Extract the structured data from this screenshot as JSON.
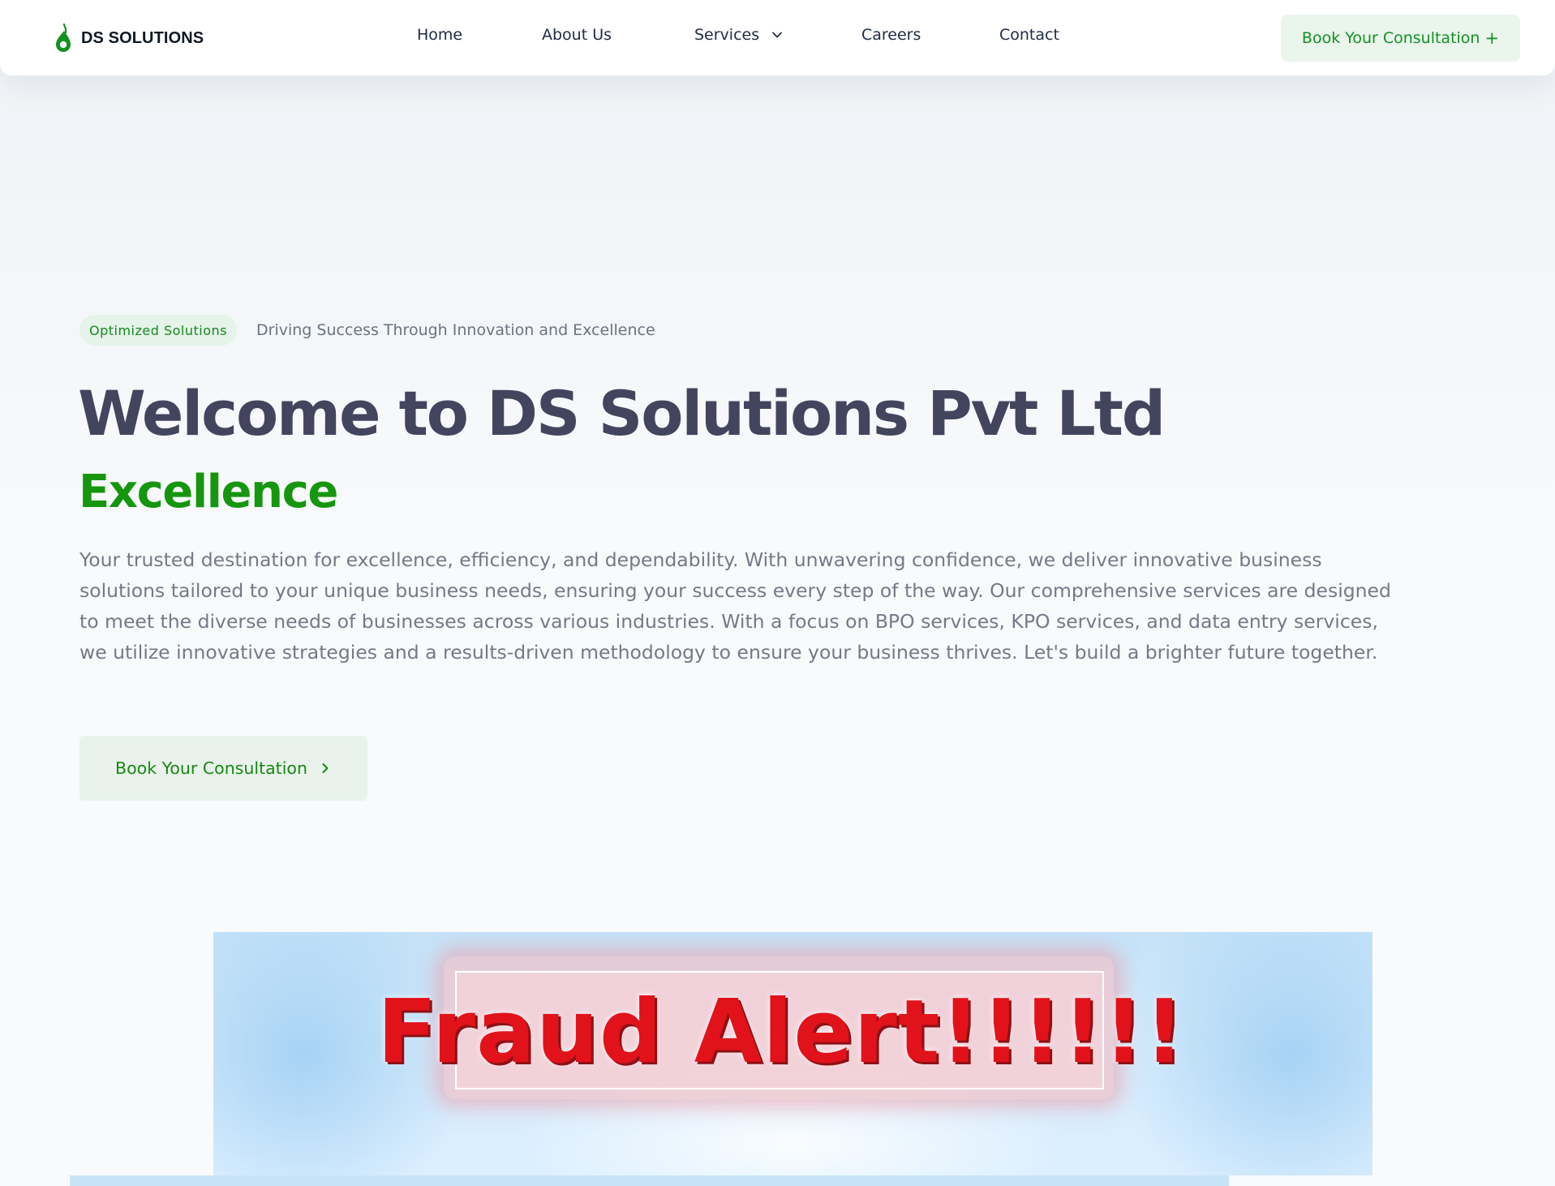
{
  "brand": {
    "name": "DS SOLUTIONS",
    "logo_icon": "ds-drop-logo",
    "color": "#149022"
  },
  "nav": {
    "items": [
      {
        "label": "Home"
      },
      {
        "label": "About Us"
      },
      {
        "label": "Services",
        "icon": "chevron-down-icon"
      },
      {
        "label": "Careers"
      },
      {
        "label": "Contact"
      }
    ],
    "cta_label": "Book Your Consultation",
    "cta_icon": "plus-icon",
    "cta_icon_glyph": "+"
  },
  "hero": {
    "badge": "Optimized Solutions",
    "tagline": "Driving Success Through Innovation and Excellence",
    "title": "Welcome to DS Solutions Pvt Ltd",
    "accent": "Excellence",
    "description": "Your trusted destination for excellence, efficiency, and dependability. With unwavering confidence, we deliver innovative business solutions tailored to your unique business needs, ensuring your success every step of the way. Our comprehensive services are designed to meet the diverse needs of businesses across various industries. With a focus on BPO services, KPO services, and data entry services, we utilize innovative strategies and a results-driven methodology to ensure your business thrives. Let's build a brighter future together.",
    "cta_label": "Book Your Consultation",
    "cta_icon": "chevron-right-icon"
  },
  "banner": {
    "alert_text": "Fraud Alert!!!!!!",
    "text_color": "#e1121a",
    "background": "#cfe7f9"
  },
  "colors": {
    "accent_green": "#16960e",
    "heading": "#43455e",
    "body_text": "#747987",
    "cta_bg": "#eaf5ec"
  }
}
